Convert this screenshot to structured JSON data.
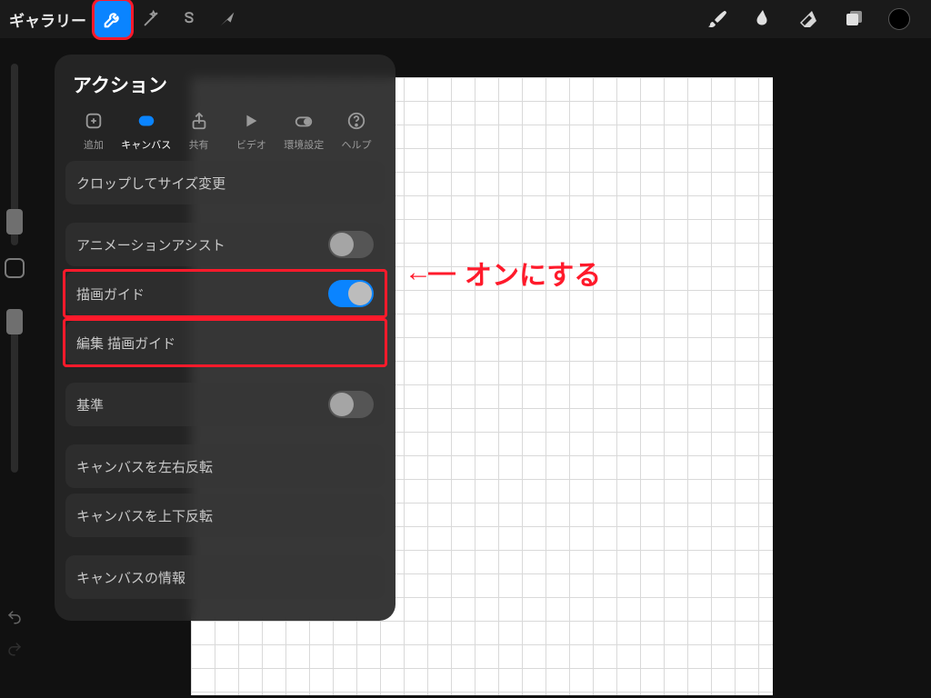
{
  "topbar": {
    "gallery_label": "ギャラリー"
  },
  "popover": {
    "title": "アクション",
    "tabs": {
      "add": "追加",
      "canvas": "キャンバス",
      "share": "共有",
      "video": "ビデオ",
      "prefs": "環境設定",
      "help": "ヘルプ"
    },
    "items": {
      "crop": "クロップしてサイズ変更",
      "anim_assist": "アニメーションアシスト",
      "draw_guide": "描画ガイド",
      "edit_guide": "編集 描画ガイド",
      "reference": "基準",
      "flip_h": "キャンバスを左右反転",
      "flip_v": "キャンバスを上下反転",
      "info": "キャンバスの情報"
    },
    "toggles": {
      "anim_assist": false,
      "draw_guide": true,
      "reference": false
    }
  },
  "annotation": {
    "arrow": "←―",
    "text": "オンにする"
  },
  "colors": {
    "accent": "#0a84ff",
    "highlight": "#ff1a2b"
  }
}
